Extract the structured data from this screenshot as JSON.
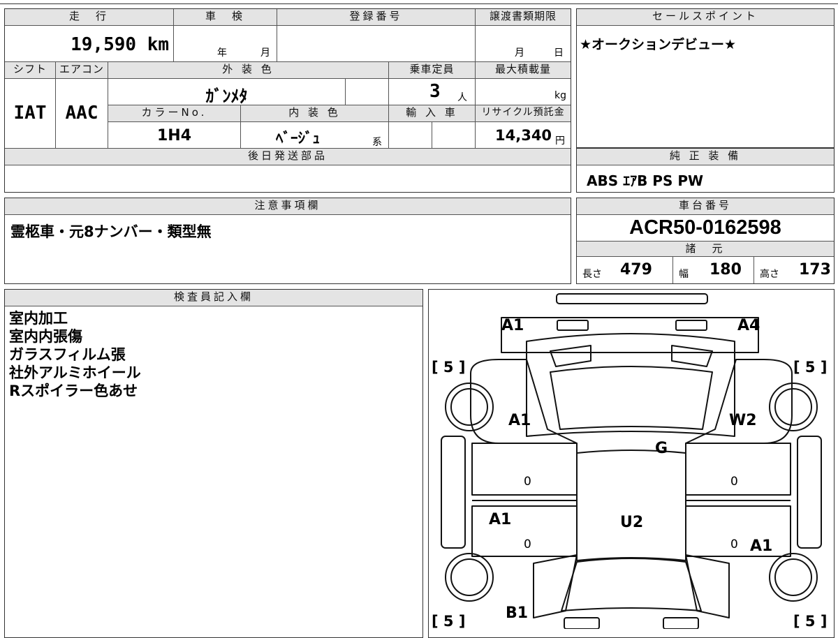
{
  "mileage": {
    "label": "走　行",
    "value": "19,590",
    "unit": "km"
  },
  "inspection": {
    "label": "車　検",
    "year_unit": "年",
    "month_unit": "月"
  },
  "registration": {
    "label": "登録番号"
  },
  "transfer_deadline": {
    "label": "譲渡書類期限",
    "month_unit": "月",
    "day_unit": "日"
  },
  "shift": {
    "label": "シフト",
    "value": "IAT"
  },
  "aircon": {
    "label": "エアコン",
    "value": "AAC"
  },
  "exterior_color": {
    "label": "外 装 色",
    "value": "ｶﾞﾝﾒﾀ"
  },
  "capacity": {
    "label": "乗車定員",
    "value": "3",
    "unit": "人"
  },
  "max_load": {
    "label": "最大積載量",
    "unit": "kg"
  },
  "color_no": {
    "label": "カラーNo.",
    "value": "1H4"
  },
  "interior_color": {
    "label": "内 装 色",
    "value": "ﾍﾞｰｼﾞｭ",
    "suffix": "系"
  },
  "import": {
    "label": "輸 入 車"
  },
  "recycle": {
    "label": "リサイクル預託金",
    "value": "14,340",
    "unit": "円"
  },
  "later_parts": {
    "label": "後日発送部品"
  },
  "sales_point": {
    "label": "セールスポイント",
    "value": "★オークションデビュー★"
  },
  "genuine_equipment": {
    "label": "純 正 装 備",
    "value": "ABS ｴｱB PS PW"
  },
  "caution": {
    "label": "注意事項欄",
    "value": "霊柩車・元8ナンバー・類型無"
  },
  "chassis": {
    "label": "車台番号",
    "value": "ACR50-0162598"
  },
  "specs": {
    "label": "諸　元",
    "length_label": "長さ",
    "length": "479",
    "width_label": "幅",
    "width": "180",
    "height_label": "高さ",
    "height": "173"
  },
  "inspector": {
    "label": "検査員記入欄",
    "notes": [
      "室内加工",
      "室内内張傷",
      "ガラスフィルム張",
      "社外アルミホイール",
      "Rスポイラー色あせ"
    ]
  },
  "diagram": {
    "a1_front_left": "A1",
    "a4_front_right": "A4",
    "tire_fl": "[ 5 ]",
    "tire_fr": "[ 5 ]",
    "tire_rl": "[ 5 ]",
    "tire_rr": "[ 5 ]",
    "a1_left_fender": "A1",
    "w2_windshield": "W2",
    "g_glass": "G",
    "u2_roof": "U2",
    "a1_left_door": "A1",
    "a1_right_door": "A1",
    "b1_left_rear": "B1",
    "zero_1": "0",
    "zero_2": "0",
    "zero_3": "0",
    "zero_4": "0"
  }
}
